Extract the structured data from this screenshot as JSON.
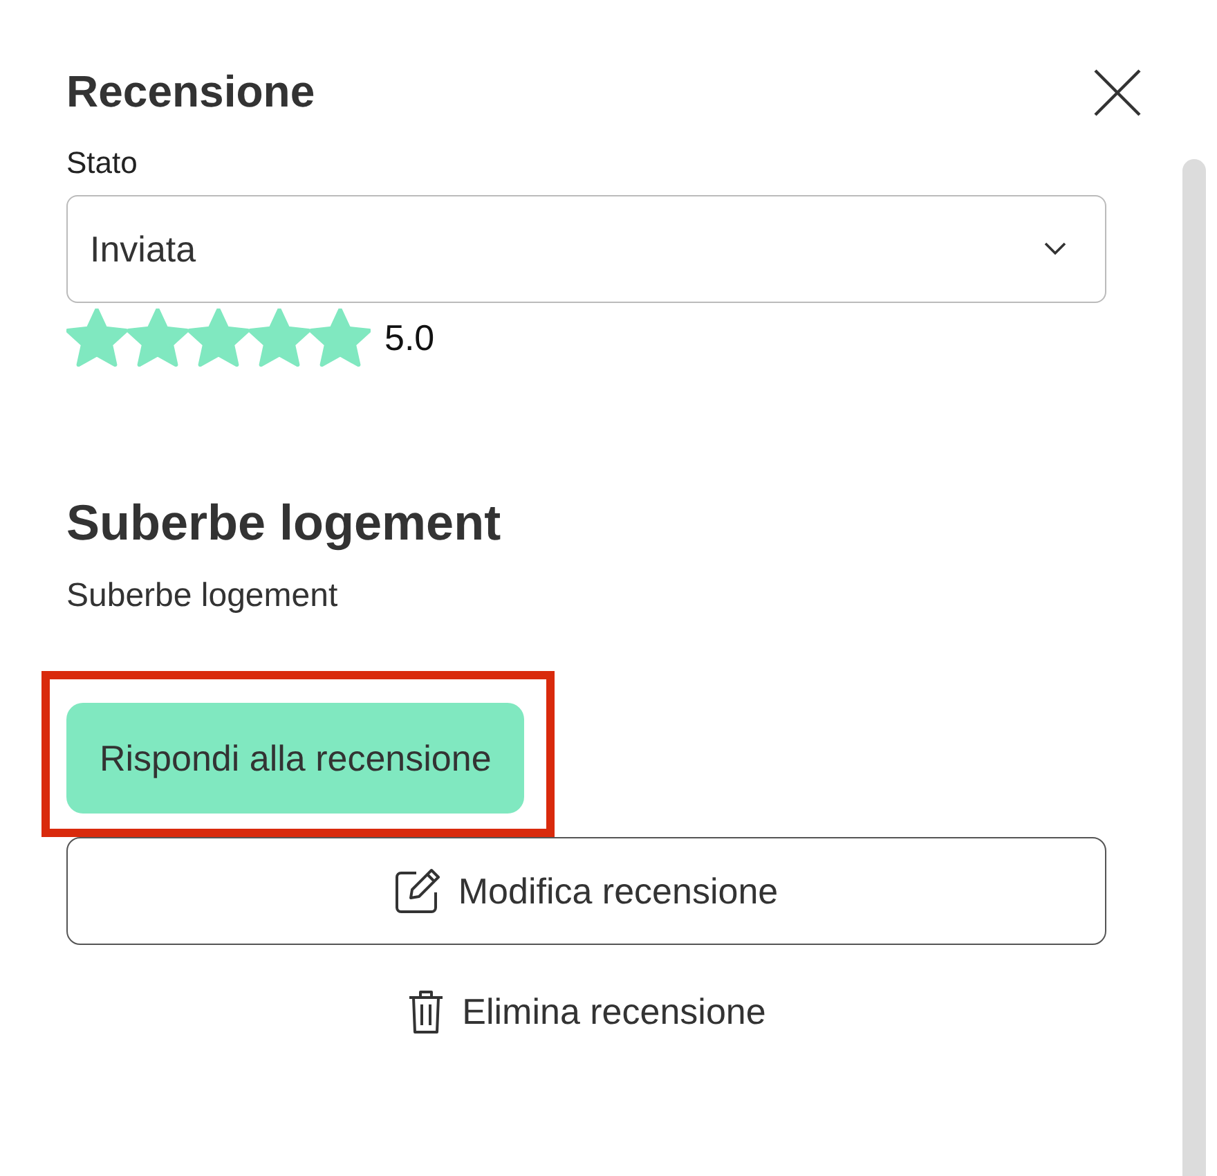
{
  "panel": {
    "title": "Recensione"
  },
  "status": {
    "label": "Stato",
    "value": "Inviata"
  },
  "rating": {
    "stars": 5,
    "score": "5.0"
  },
  "review": {
    "title": "Suberbe logement",
    "text": "Suberbe logement"
  },
  "actions": [
    {
      "kind": "primary",
      "label": "Rispondi alla recensione",
      "highlighted": true
    },
    {
      "kind": "outline",
      "label": "Modifica recensione",
      "highlighted": false
    },
    {
      "kind": "link",
      "label": "Elimina recensione",
      "highlighted": false
    }
  ]
}
